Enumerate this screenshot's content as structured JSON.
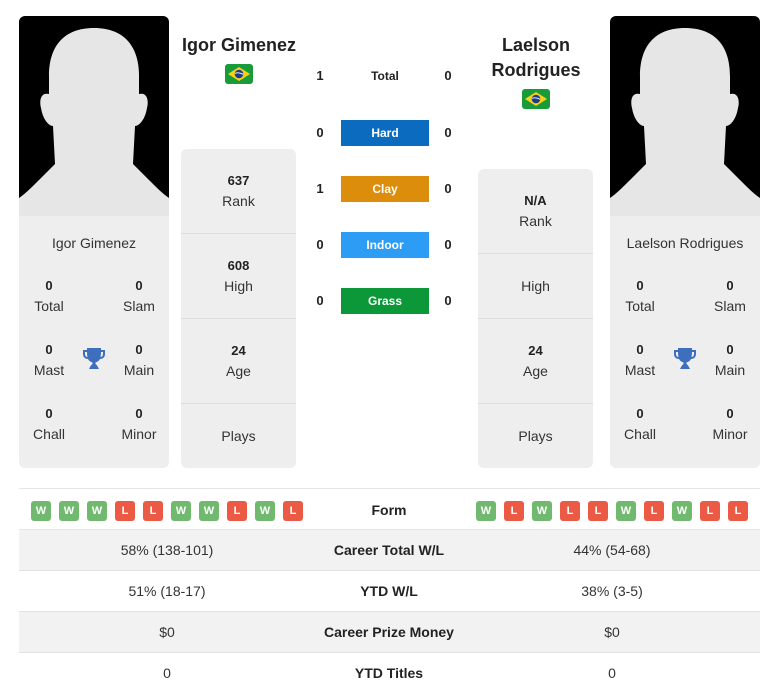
{
  "colors": {
    "hard": "#0a6bbf",
    "clay": "#dc8d0b",
    "indoor": "#2c9cf5",
    "grass": "#0c9738",
    "win": "#70b96e",
    "loss": "#ea5a44",
    "trophy": "#3e6fbf"
  },
  "player1": {
    "name": "Igor Gimenez",
    "country_flag": "brazil-flag-icon",
    "titles": {
      "total": {
        "value": "0",
        "label": "Total"
      },
      "slam": {
        "value": "0",
        "label": "Slam"
      },
      "mast": {
        "value": "0",
        "label": "Mast"
      },
      "main": {
        "value": "0",
        "label": "Main"
      },
      "chall": {
        "value": "0",
        "label": "Chall"
      },
      "minor": {
        "value": "0",
        "label": "Minor"
      }
    },
    "stats": {
      "rank": {
        "value": "637",
        "label": "Rank"
      },
      "high": {
        "value": "608",
        "label": "High"
      },
      "age": {
        "value": "24",
        "label": "Age"
      },
      "plays": {
        "value": "",
        "label": "Plays"
      }
    },
    "form": [
      "W",
      "W",
      "W",
      "L",
      "L",
      "W",
      "W",
      "L",
      "W",
      "L"
    ]
  },
  "player2": {
    "name_line1": "Laelson",
    "name_line2": "Rodrigues",
    "name": "Laelson Rodrigues",
    "country_flag": "brazil-flag-icon",
    "titles": {
      "total": {
        "value": "0",
        "label": "Total"
      },
      "slam": {
        "value": "0",
        "label": "Slam"
      },
      "mast": {
        "value": "0",
        "label": "Mast"
      },
      "main": {
        "value": "0",
        "label": "Main"
      },
      "chall": {
        "value": "0",
        "label": "Chall"
      },
      "minor": {
        "value": "0",
        "label": "Minor"
      }
    },
    "stats": {
      "rank": {
        "value": "N/A",
        "label": "Rank"
      },
      "high": {
        "value": "",
        "label": "High"
      },
      "age": {
        "value": "24",
        "label": "Age"
      },
      "plays": {
        "value": "",
        "label": "Plays"
      }
    },
    "form": [
      "W",
      "L",
      "W",
      "L",
      "L",
      "W",
      "L",
      "W",
      "L",
      "L"
    ]
  },
  "h2h": [
    {
      "label": "Total",
      "p1": "1",
      "p2": "0",
      "kind": "total"
    },
    {
      "label": "Hard",
      "p1": "0",
      "p2": "0",
      "kind": "hard"
    },
    {
      "label": "Clay",
      "p1": "1",
      "p2": "0",
      "kind": "clay"
    },
    {
      "label": "Indoor",
      "p1": "0",
      "p2": "0",
      "kind": "indoor"
    },
    {
      "label": "Grass",
      "p1": "0",
      "p2": "0",
      "kind": "grass"
    }
  ],
  "form_label": "Form",
  "comparison": [
    {
      "label": "Career Total W/L",
      "p1": "58% (138-101)",
      "p2": "44% (54-68)"
    },
    {
      "label": "YTD W/L",
      "p1": "51% (18-17)",
      "p2": "38% (3-5)"
    },
    {
      "label": "Career Prize Money",
      "p1": "$0",
      "p2": "$0"
    },
    {
      "label": "YTD Titles",
      "p1": "0",
      "p2": "0"
    }
  ]
}
